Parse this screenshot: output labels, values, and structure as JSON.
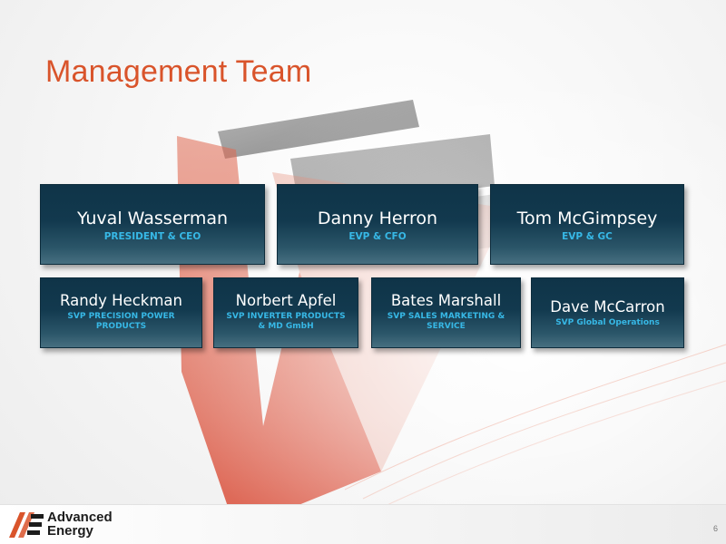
{
  "slide": {
    "title": "Management Team",
    "page_number": "6"
  },
  "team": {
    "row1": [
      {
        "name": "Yuval Wasserman",
        "role": "PRESIDENT & CEO"
      },
      {
        "name": "Danny Herron",
        "role": "EVP & CFO"
      },
      {
        "name": "Tom McGimpsey",
        "role": "EVP & GC"
      }
    ],
    "row2": [
      {
        "name": "Randy Heckman",
        "role": "SVP PRECISION POWER PRODUCTS"
      },
      {
        "name": "Norbert Apfel",
        "role": "SVP INVERTER PRODUCTS & MD GmbH"
      },
      {
        "name": "Bates Marshall",
        "role": "SVP SALES MARKETING & SERVICE"
      },
      {
        "name": "Dave McCarron",
        "role": "SVP Global Operations"
      }
    ]
  },
  "brand": {
    "line1": "Advanced",
    "line2": "Energy",
    "accent_color": "#d9542b",
    "card_color": "#12394e",
    "role_color": "#37b8e6"
  }
}
